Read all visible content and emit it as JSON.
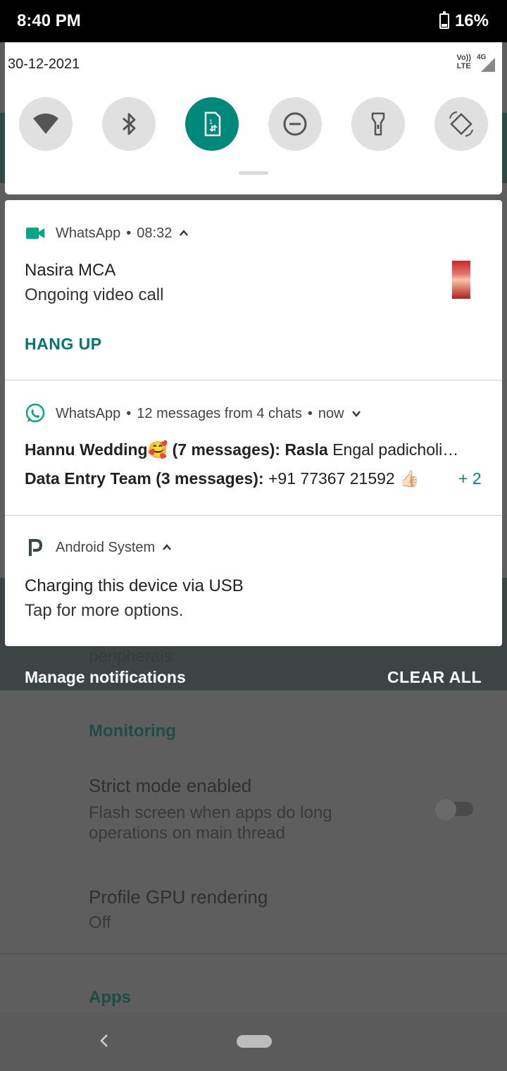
{
  "status_bar": {
    "time": "8:40 PM",
    "battery_percent": "16%"
  },
  "quick_settings": {
    "date": "30-12-2021",
    "network": {
      "volte": "Vo)) LTE",
      "type": "4G"
    },
    "tiles": [
      {
        "name": "wifi",
        "active": false
      },
      {
        "name": "bluetooth",
        "active": false
      },
      {
        "name": "mobile-data",
        "active": true
      },
      {
        "name": "do-not-disturb",
        "active": false
      },
      {
        "name": "flashlight",
        "active": false
      },
      {
        "name": "auto-rotate",
        "active": false
      }
    ]
  },
  "notifications": {
    "call": {
      "app": "WhatsApp",
      "time": "08:32",
      "title": "Nasira MCA",
      "body": "Ongoing video call",
      "action": "HANG UP"
    },
    "messages": {
      "app": "WhatsApp",
      "summary": "12 messages from 4 chats",
      "time": "now",
      "line1_bold": "Hannu Wedding🥰 (7 messages): Rasla",
      "line1_text": " Engal padicholi…",
      "line2_bold": "Data Entry Team  (3 messages):",
      "line2_text": " +91 77367 21592 👍🏻",
      "more": "+ 2"
    },
    "system": {
      "app": "Android System",
      "title": "Charging this device via USB",
      "body": "Tap for more options."
    }
  },
  "footer": {
    "manage": "Manage notifications",
    "clear_all": "CLEAR ALL"
  },
  "background_app": {
    "peripherals": "peripherals",
    "section_monitoring": "Monitoring",
    "strict_title": "Strict mode enabled",
    "strict_sub1": "Flash screen when apps do long",
    "strict_sub2": "operations on main thread",
    "gpu_title": "Profile GPU rendering",
    "gpu_value": "Off",
    "section_apps": "Apps"
  },
  "colors": {
    "accent": "#00897b",
    "whatsapp_green": "#00a884"
  }
}
